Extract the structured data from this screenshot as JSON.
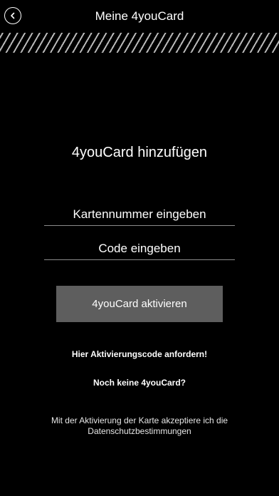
{
  "header": {
    "title": "Meine 4youCard",
    "back_icon": "chevron-left-icon"
  },
  "main": {
    "title": "4youCard hinzufügen",
    "card_number_field": {
      "placeholder": "Kartennummer eingeben",
      "value": ""
    },
    "code_field": {
      "placeholder": "Code eingeben",
      "value": ""
    },
    "activate_label": "4youCard aktivieren",
    "request_code_link": "Hier Aktivierungscode anfordern!",
    "no_card_link": "Noch keine 4youCard?",
    "consent_line1": "Mit der Aktivierung der Karte akzeptiere ich die",
    "consent_line2": "Datenschutzbestimmungen"
  },
  "colors": {
    "background": "#000000",
    "text": "#ffffff",
    "button": "#5e5e5e",
    "divider": "#8a8a8a",
    "stripe": "#b8b8b8"
  }
}
